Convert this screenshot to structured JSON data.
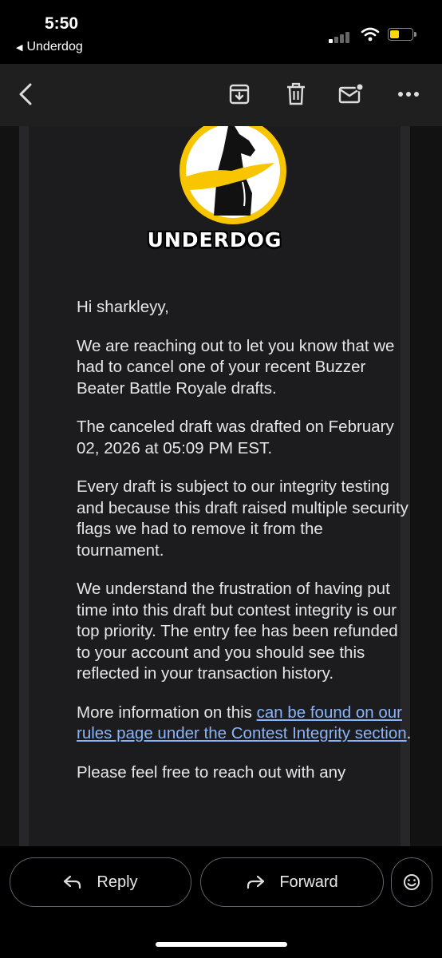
{
  "status": {
    "time": "5:50",
    "back_app": "Underdog"
  },
  "toolbar": {
    "back": "back-icon",
    "archive": "archive-icon",
    "delete": "trash-icon",
    "unread": "mark-unread-icon",
    "more": "more-icon"
  },
  "email": {
    "brand": "UNDERDOG",
    "greeting": "Hi sharkleyy,",
    "p1": "We are reaching out to let you know that we had to cancel one of your recent Buzzer Beater Battle Royale drafts.",
    "p2": "The canceled draft was drafted on February 02, 2026 at 05:09 PM EST.",
    "p3": "Every draft is subject to our integrity testing and because this draft raised multiple security flags we had to remove it from the tournament.",
    "p4": "We understand the frustration of having put time into this draft but contest integrity is our top priority. The entry fee has been refunded to your account and you should see this reflected in your transaction history.",
    "p5_prefix": "More information on this ",
    "p5_link": "can be found on our rules page under the Contest Integrity section",
    "p5_suffix": ".",
    "p6_partial": "Please feel free to reach out with any"
  },
  "actions": {
    "reply": "Reply",
    "forward": "Forward",
    "emoji": "emoji-reaction-icon"
  },
  "colors": {
    "link": "#8ab4f8",
    "logo_yellow": "#f7c600",
    "battery": "#ffd60a"
  }
}
